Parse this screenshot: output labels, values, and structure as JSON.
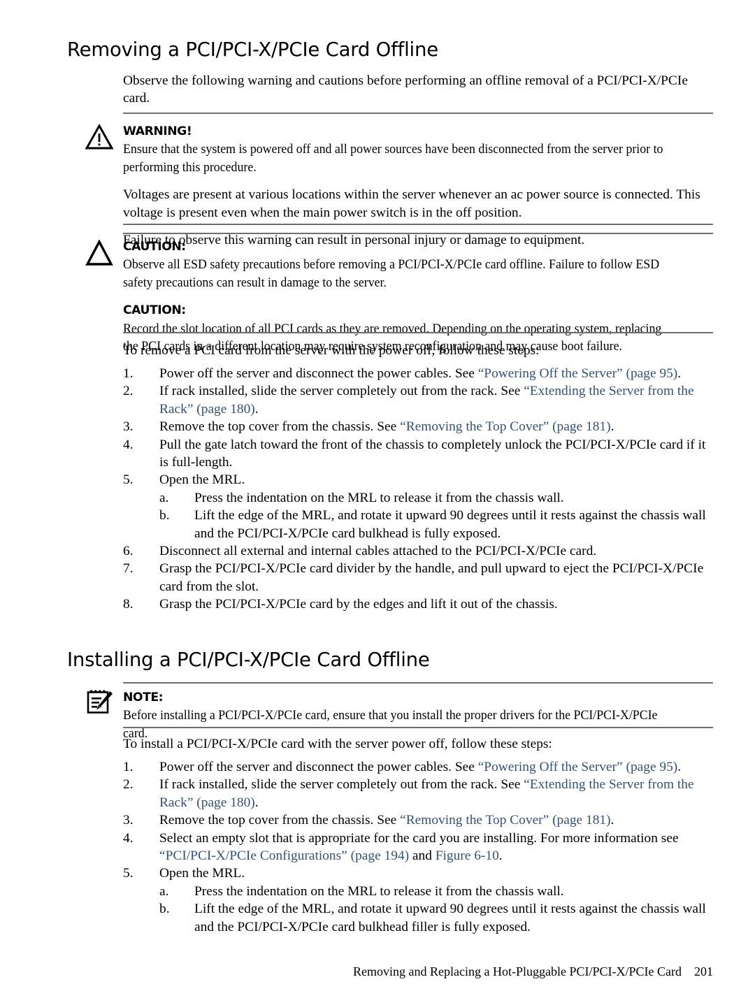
{
  "document": {
    "heading_1": "Removing a PCI/PCI-X/PCIe Card Offline",
    "intro_1": "Observe the following warning and cautions before performing an offline removal of a PCI/PCI-X/PCIe card.",
    "heading_2": "Installing a PCI/PCI-X/PCIe Card Offline"
  },
  "warning": {
    "icon": "warning-triangle-icon",
    "label": "WARNING!",
    "paragraphs": [
      "Ensure that the system is powered off and all power sources have been disconnected from the server prior to performing this procedure.",
      "Voltages are present at various locations within the server whenever an ac power source is connected. This voltage is present even when the main power switch is in the off position.",
      "Failure to observe this warning can result in personal injury or damage to equipment."
    ]
  },
  "caution_1": {
    "icon": "caution-triangle-icon",
    "label": "CAUTION:",
    "text": "Observe all ESD safety precautions before removing a PCI/PCI-X/PCIe card offline. Failure to follow ESD safety precautions can result in damage to the server."
  },
  "caution_2": {
    "label": "CAUTION:",
    "text": "Record the slot location of all PCI cards as they are removed. Depending on the operating system, replacing the PCI cards in a different location may require system reconfiguration and may cause boot failure."
  },
  "note": {
    "icon": "note-notepad-pencil-icon",
    "label": "NOTE:",
    "text": "Before installing a PCI/PCI-X/PCIe card, ensure that you install the proper drivers for the PCI/PCI-X/PCIe card."
  },
  "removal_procedure": {
    "lead_in": "To remove a PCI card from the server with the power off, follow these steps:",
    "steps": [
      {
        "marker": "1.",
        "parts": [
          {
            "t": "Power off the server and disconnect the power cables. See ",
            "link": false
          },
          {
            "t": "“Powering Off the Server” (page 95)",
            "link": true
          },
          {
            "t": ".",
            "link": false
          }
        ]
      },
      {
        "marker": "2.",
        "parts": [
          {
            "t": "If rack installed, slide the server completely out from the rack. See ",
            "link": false
          },
          {
            "t": "“Extending the Server from the Rack” (page 180)",
            "link": true
          },
          {
            "t": ".",
            "link": false
          }
        ]
      },
      {
        "marker": "3.",
        "parts": [
          {
            "t": "Remove the top cover from the chassis. See ",
            "link": false
          },
          {
            "t": "“Removing the Top Cover” (page 181)",
            "link": true
          },
          {
            "t": ".",
            "link": false
          }
        ]
      },
      {
        "marker": "4.",
        "parts": [
          {
            "t": "Pull the gate latch toward the front of the chassis to completely unlock the PCI/PCI-X/PCIe card if it is full-length.",
            "link": false
          }
        ]
      },
      {
        "marker": "5.",
        "parts": [
          {
            "t": "Open the MRL.",
            "link": false
          }
        ],
        "substeps": [
          {
            "marker": "a.",
            "text": "Press the indentation on the MRL to release it from the chassis wall."
          },
          {
            "marker": "b.",
            "text": "Lift the edge of the MRL, and rotate it upward 90 degrees until it rests against the chassis wall and the PCI/PCI-X/PCIe card bulkhead is fully exposed."
          }
        ]
      },
      {
        "marker": "6.",
        "parts": [
          {
            "t": "Disconnect all external and internal cables attached to the PCI/PCI-X/PCIe card.",
            "link": false
          }
        ]
      },
      {
        "marker": "7.",
        "parts": [
          {
            "t": "Grasp the PCI/PCI-X/PCIe card divider by the handle, and pull upward to eject the PCI/PCI-X/PCIe card from the slot.",
            "link": false
          }
        ]
      },
      {
        "marker": "8.",
        "parts": [
          {
            "t": "Grasp the PCI/PCI-X/PCIe card by the edges and lift it out of the chassis.",
            "link": false
          }
        ]
      }
    ]
  },
  "install_procedure": {
    "lead_in": "To install a PCI/PCI-X/PCIe card with the server power off, follow these steps:",
    "steps": [
      {
        "marker": "1.",
        "parts": [
          {
            "t": "Power off the server and disconnect the power cables. See ",
            "link": false
          },
          {
            "t": "“Powering Off the Server” (page 95)",
            "link": true
          },
          {
            "t": ".",
            "link": false
          }
        ]
      },
      {
        "marker": "2.",
        "parts": [
          {
            "t": "If rack installed, slide the server completely out from the rack. See ",
            "link": false
          },
          {
            "t": "“Extending the Server from the Rack” (page 180)",
            "link": true
          },
          {
            "t": ".",
            "link": false
          }
        ]
      },
      {
        "marker": "3.",
        "parts": [
          {
            "t": "Remove the top cover from the chassis. See ",
            "link": false
          },
          {
            "t": "“Removing the Top Cover” (page 181)",
            "link": true
          },
          {
            "t": ".",
            "link": false
          }
        ]
      },
      {
        "marker": "4.",
        "parts": [
          {
            "t": "Select an empty slot that is appropriate for the card you are installing. For more information see ",
            "link": false
          },
          {
            "t": "“PCI/PCI-X/PCIe Configurations” (page 194)",
            "link": true
          },
          {
            "t": " and ",
            "link": false
          },
          {
            "t": "Figure 6-10",
            "link": true
          },
          {
            "t": ".",
            "link": false
          }
        ]
      },
      {
        "marker": "5.",
        "parts": [
          {
            "t": "Open the MRL.",
            "link": false
          }
        ],
        "substeps": [
          {
            "marker": "a.",
            "text": "Press the indentation on the MRL to release it from the chassis wall."
          },
          {
            "marker": "b.",
            "text": "Lift the edge of the MRL, and rotate it upward 90 degrees until it rests against the chassis wall and the PCI/PCI-X/PCIe card bulkhead filler is fully exposed."
          }
        ]
      }
    ]
  },
  "footer": {
    "running_title": "Removing and Replacing a Hot-Pluggable PCI/PCI-X/PCIe Card",
    "page_number": "201"
  },
  "colors": {
    "link": "#33527b",
    "rule": "#6e6e6e",
    "text": "#000000"
  }
}
